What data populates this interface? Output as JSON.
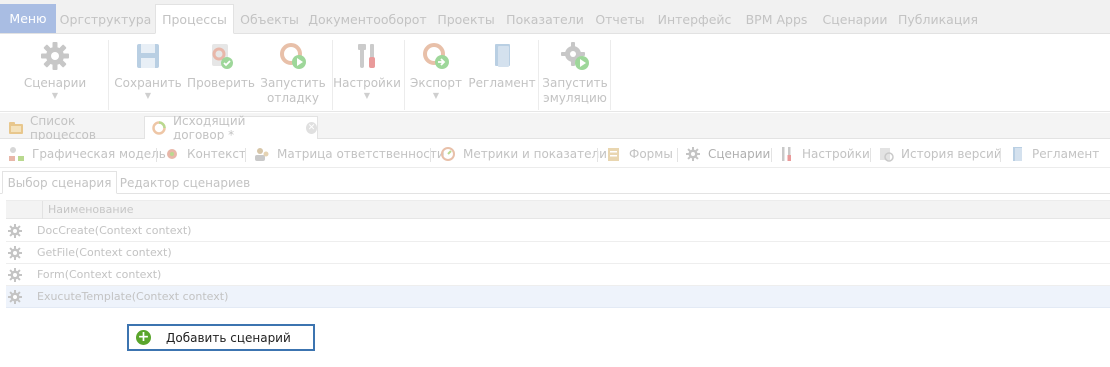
{
  "menubar": {
    "menu_label": "Меню",
    "tabs": [
      {
        "label": "Оргструктура"
      },
      {
        "label": "Процессы"
      },
      {
        "label": "Объекты"
      },
      {
        "label": "Документооборот"
      },
      {
        "label": "Проекты"
      },
      {
        "label": "Показатели"
      },
      {
        "label": "Отчеты"
      },
      {
        "label": "Интерфейс"
      },
      {
        "label": "BPM Apps"
      },
      {
        "label": "Сценарии"
      },
      {
        "label": "Публикация"
      }
    ]
  },
  "ribbon": {
    "buttons": [
      {
        "label": "Сценарии",
        "label2": "",
        "icon": "gear-icon"
      },
      {
        "label": "Сохранить",
        "label2": "",
        "icon": "save-icon"
      },
      {
        "label": "Проверить",
        "label2": "",
        "icon": "check-process-icon"
      },
      {
        "label": "Запустить",
        "label2": "отладку",
        "icon": "run-debug-icon"
      },
      {
        "label": "Настройки",
        "label2": "",
        "icon": "tools-icon"
      },
      {
        "label": "Экспорт",
        "label2": "",
        "icon": "export-icon"
      },
      {
        "label": "Регламент",
        "label2": "",
        "icon": "document-icon"
      },
      {
        "label": "Запустить",
        "label2": "эмуляцию",
        "icon": "run-emulation-icon"
      }
    ]
  },
  "doctabs": {
    "tabs": [
      {
        "label": "Список процессов"
      },
      {
        "label": "Исходящий договор *"
      }
    ]
  },
  "sections": {
    "items": [
      {
        "label": "Графическая модель"
      },
      {
        "label": "Контекст"
      },
      {
        "label": "Матрица ответственности"
      },
      {
        "label": "Метрики и показатели"
      },
      {
        "label": "Формы"
      },
      {
        "label": "Сценарии"
      },
      {
        "label": "Настройки"
      },
      {
        "label": "История версий"
      },
      {
        "label": "Регламент"
      }
    ]
  },
  "subtabs": {
    "tabs": [
      {
        "label": "Выбор сценария"
      },
      {
        "label": "Редактор сценариев"
      }
    ]
  },
  "grid": {
    "column_name": "Наименование",
    "rows": [
      {
        "name": "DocCreate(Context context)"
      },
      {
        "name": "GetFile(Context context)"
      },
      {
        "name": "Form(Context context)"
      },
      {
        "name": "ExucuteTemplate(Context context)"
      }
    ]
  },
  "actions": {
    "add_scenario": "Добавить сценарий"
  },
  "colors": {
    "accent_border": "#3c74b0",
    "add_icon": "#5aa52c",
    "menu_button": "#a9bde3",
    "selected_row": "#eef3fb"
  }
}
